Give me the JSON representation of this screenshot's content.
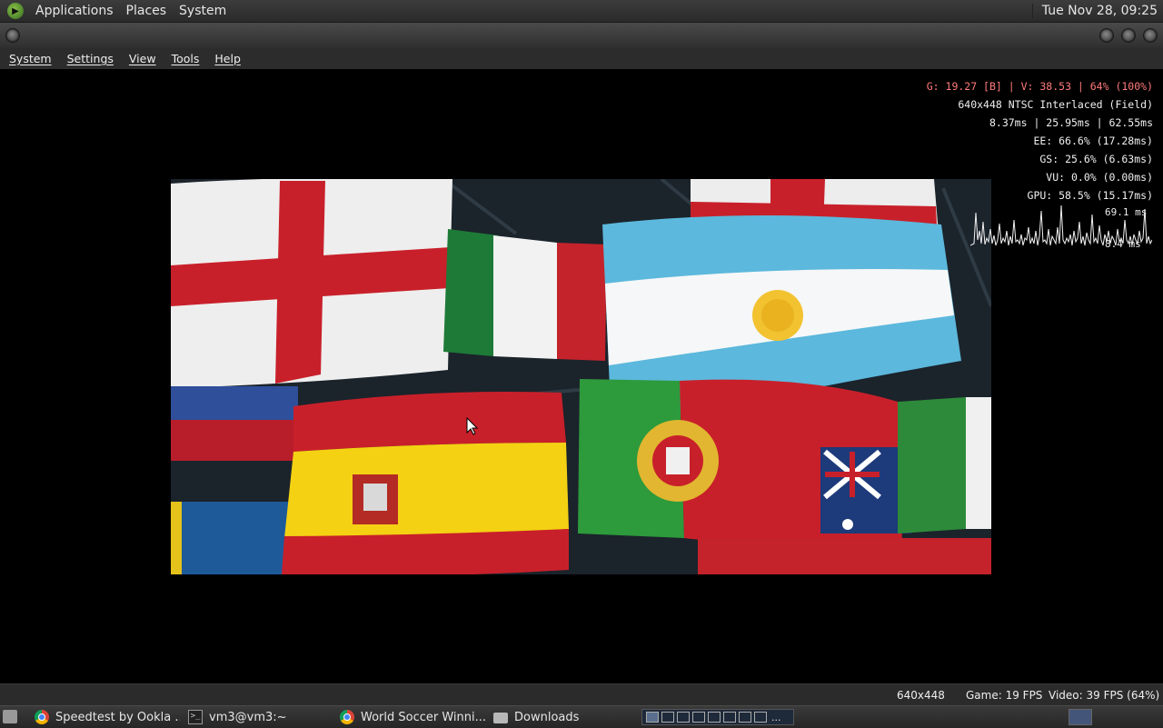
{
  "top_panel": {
    "menus": [
      "Applications",
      "Places",
      "System"
    ],
    "clock": "Tue Nov 28, 09:25"
  },
  "app_menu": [
    "System",
    "Settings",
    "View",
    "Tools",
    "Help"
  ],
  "osd": {
    "line1": "G: 19.27 [B] | V: 38.53 | 64% (100%)",
    "line2": "640x448 NTSC Interlaced (Field)",
    "line3": "8.37ms | 25.95ms | 62.55ms",
    "line4": "EE: 66.6% (17.28ms)",
    "line5": "GS: 25.6% (6.63ms)",
    "line6": "VU: 0.0% (0.00ms)",
    "line7": "GPU: 58.5% (15.17ms)",
    "graph_max": "69.1 ms",
    "graph_min": "8.4 ms",
    "line1_color": "#ff7a7a"
  },
  "status_bar": {
    "resolution": "640x448",
    "game_fps": "Game: 19 FPS",
    "video_fps": "Video: 39 FPS (64%)"
  },
  "taskbar": {
    "tasks": [
      {
        "label": "Speedtest by Ookla ...",
        "icon": "chrome-icon"
      },
      {
        "label": "vm3@vm3:~",
        "icon": "terminal-icon"
      },
      {
        "label": "World Soccer Winni...",
        "icon": "chrome-icon"
      },
      {
        "label": "Downloads",
        "icon": "folder-icon"
      }
    ],
    "pager_more": "..."
  }
}
